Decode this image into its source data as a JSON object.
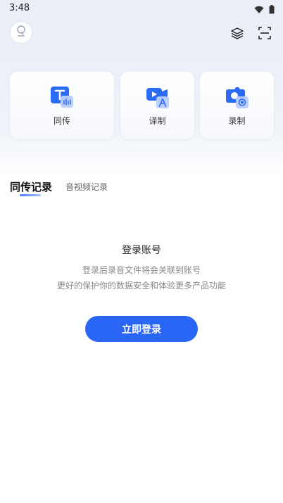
{
  "status": {
    "time": "3:48"
  },
  "cards": [
    {
      "label": "同传",
      "icon": "text-audio-icon"
    },
    {
      "label": "译制",
      "icon": "video-translate-icon"
    },
    {
      "label": "录制",
      "icon": "camera-record-icon"
    }
  ],
  "tabs": {
    "active": "同传记录",
    "inactive": "音视频记录"
  },
  "empty": {
    "title": "登录账号",
    "line1": "登录后录音文件将会关联到账号",
    "line2": "更好的保护你的数据安全和体验更多产品功能"
  },
  "login_button": "立即登录",
  "colors": {
    "accent": "#2a66f5",
    "icon_blue": "#2a6cf6",
    "icon_light": "#b9cdfb"
  }
}
